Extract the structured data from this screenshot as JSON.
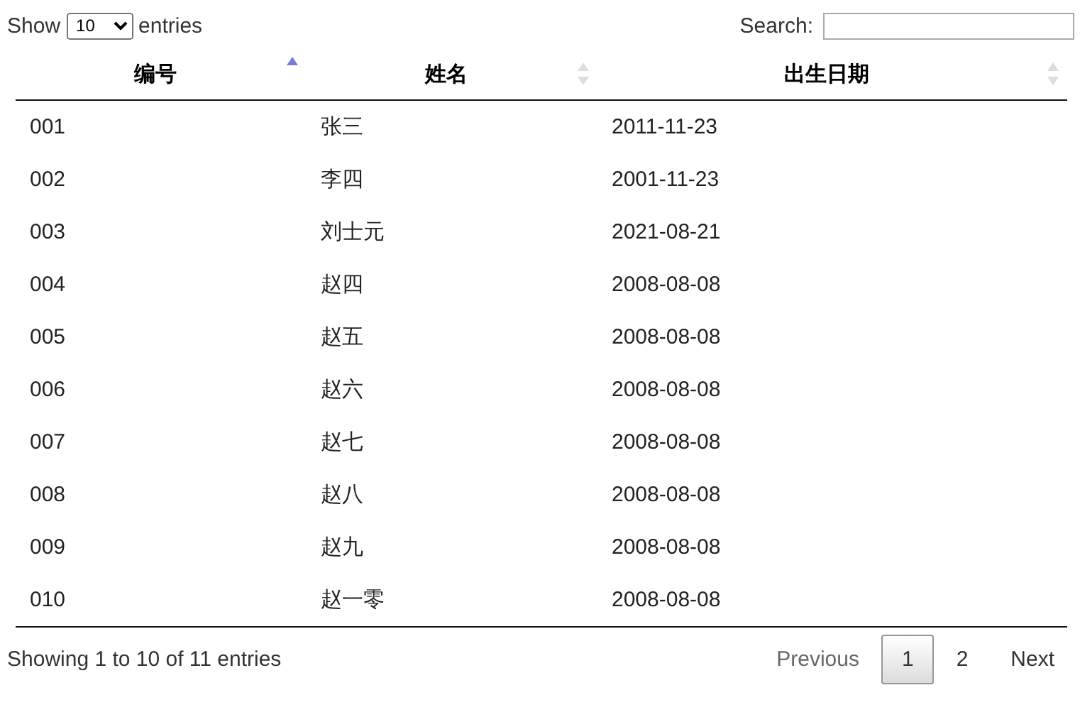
{
  "length": {
    "label_before": "Show",
    "value": "10",
    "label_after": "entries"
  },
  "search": {
    "label": "Search:"
  },
  "table": {
    "columns": [
      {
        "label": "编号",
        "sorted": true
      },
      {
        "label": "姓名",
        "sorted": false
      },
      {
        "label": "出生日期",
        "sorted": false
      }
    ],
    "rows": [
      [
        "001",
        "张三",
        "2011-11-23"
      ],
      [
        "002",
        "李四",
        "2001-11-23"
      ],
      [
        "003",
        "刘士元",
        "2021-08-21"
      ],
      [
        "004",
        "赵四",
        "2008-08-08"
      ],
      [
        "005",
        "赵五",
        "2008-08-08"
      ],
      [
        "006",
        "赵六",
        "2008-08-08"
      ],
      [
        "007",
        "赵七",
        "2008-08-08"
      ],
      [
        "008",
        "赵八",
        "2008-08-08"
      ],
      [
        "009",
        "赵九",
        "2008-08-08"
      ],
      [
        "010",
        "赵一零",
        "2008-08-08"
      ]
    ]
  },
  "info": "Showing 1 to 10 of 11 entries",
  "pagination": {
    "previous": {
      "label": "Previous",
      "disabled": true
    },
    "pages": [
      {
        "label": "1",
        "selected": true
      },
      {
        "label": "2",
        "selected": false
      }
    ],
    "next": {
      "label": "Next",
      "disabled": false
    }
  }
}
